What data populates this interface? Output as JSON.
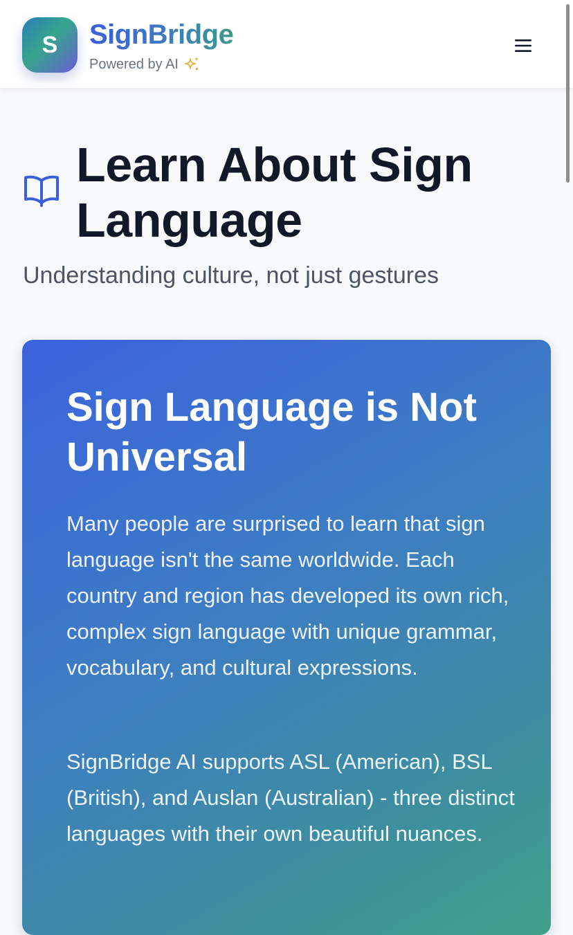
{
  "header": {
    "logo_letter": "S",
    "brand_name": "SignBridge",
    "tagline": "Powered by AI",
    "tagline_icon": "sparkles-icon",
    "menu_icon": "hamburger-menu-icon"
  },
  "page": {
    "title_icon": "open-book-icon",
    "title": "Learn About Sign Language",
    "subtitle": "Understanding culture, not just gestures"
  },
  "card": {
    "title": "Sign Language is Not Universal",
    "paragraphs": [
      "Many people are surprised to learn that sign language isn't the same worldwide. Each country and region has developed its own rich, complex sign language with unique grammar, vocabulary, and cultural expressions.",
      "SignBridge AI supports ASL (American), BSL (British), and Auslan (Australian) - three distinct languages with their own beautiful nuances."
    ]
  },
  "colors": {
    "brand_gradient_start": "#3b5fd9",
    "brand_gradient_end": "#3c9a86",
    "title_text": "#111827",
    "subtitle_text": "#4b5563",
    "icon_blue": "#3b5fd9",
    "sparkle_gold": "#e0b23a",
    "card_gradient_start": "#3b63de",
    "card_gradient_end": "#41a089"
  }
}
